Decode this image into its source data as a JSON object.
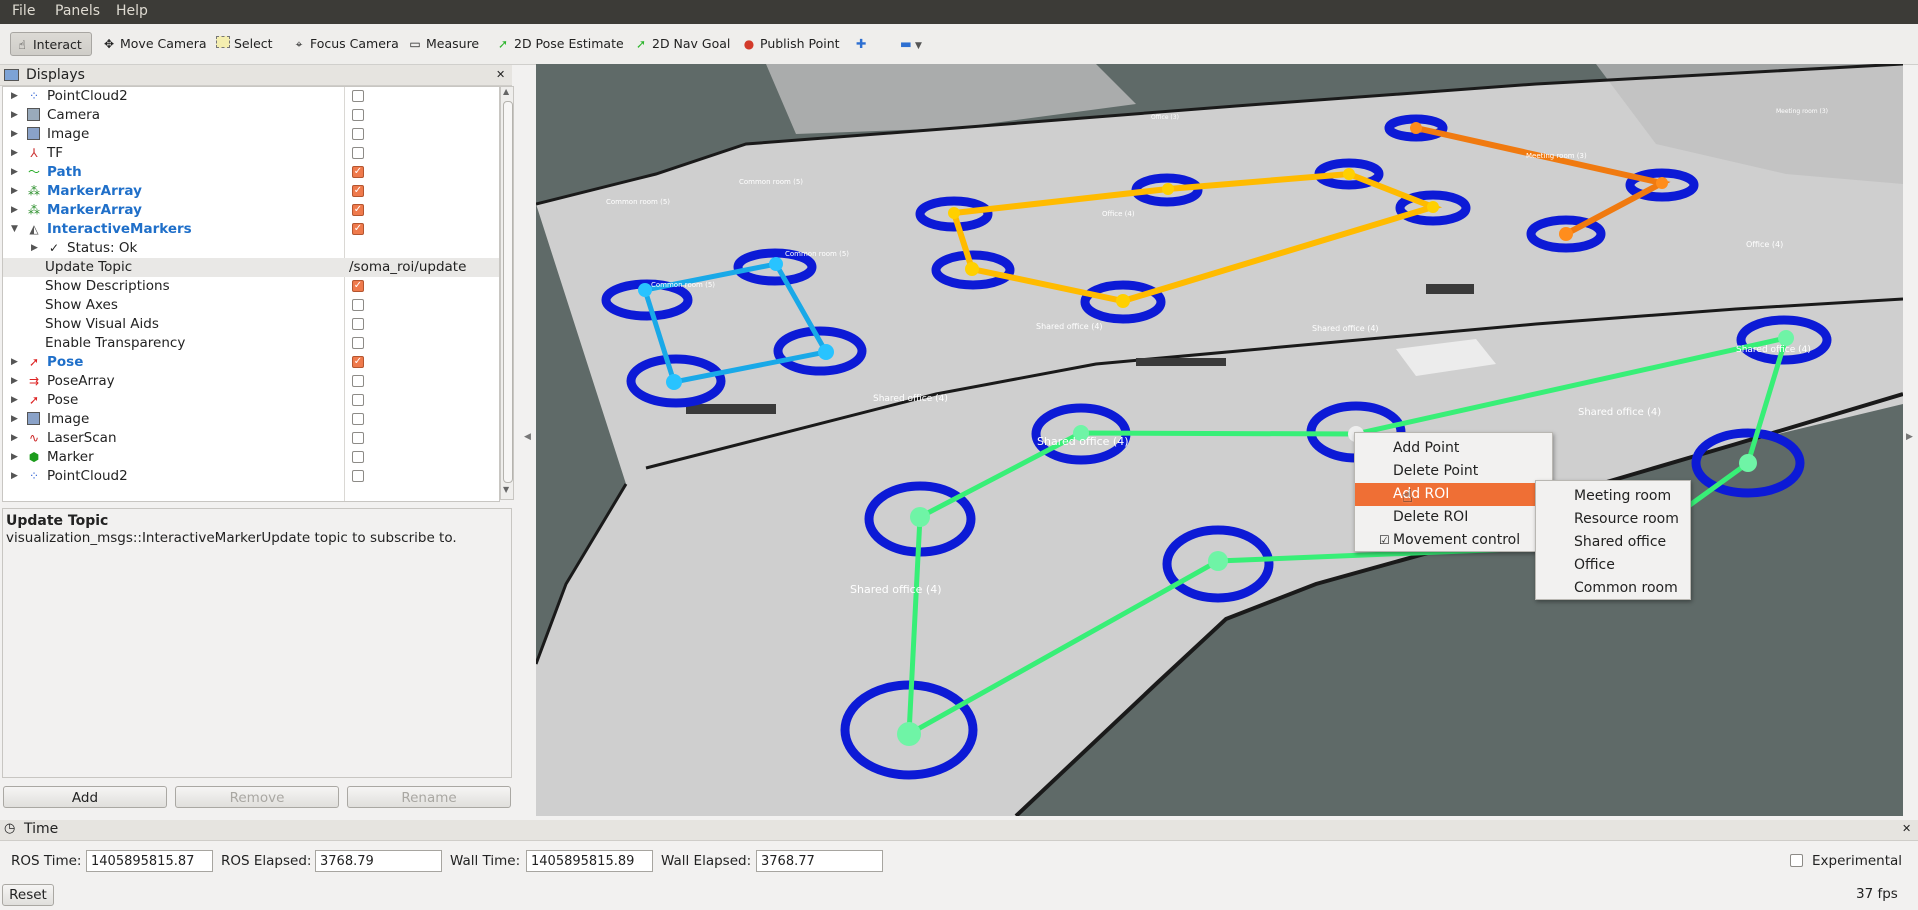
{
  "menu": [
    "File",
    "Panels",
    "Help"
  ],
  "toolbar": {
    "interact": "Interact",
    "move_camera": "Move Camera",
    "select": "Select",
    "focus_camera": "Focus Camera",
    "measure": "Measure",
    "pose_estimate": "2D Pose Estimate",
    "nav_goal": "2D Nav Goal",
    "publish_point": "Publish Point"
  },
  "displays": {
    "title": "Displays",
    "rows": [
      {
        "label": "PointCloud2"
      },
      {
        "label": "Camera"
      },
      {
        "label": "Image"
      },
      {
        "label": "TF"
      },
      {
        "label": "Path"
      },
      {
        "label": "MarkerArray"
      },
      {
        "label": "MarkerArray"
      },
      {
        "label": "InteractiveMarkers"
      },
      {
        "label": "Status: Ok"
      },
      {
        "label": "Update Topic",
        "value": "/soma_roi/update"
      },
      {
        "label": "Show Descriptions"
      },
      {
        "label": "Show Axes"
      },
      {
        "label": "Show Visual Aids"
      },
      {
        "label": "Enable Transparency"
      },
      {
        "label": "Pose"
      },
      {
        "label": "PoseArray"
      },
      {
        "label": "Pose"
      },
      {
        "label": "Image"
      },
      {
        "label": "LaserScan"
      },
      {
        "label": "Marker"
      },
      {
        "label": "PointCloud2"
      }
    ]
  },
  "description": {
    "title": "Update Topic",
    "text": "visualization_msgs::InteractiveMarkerUpdate topic to subscribe to."
  },
  "buttons": {
    "add": "Add",
    "remove": "Remove",
    "rename": "Rename"
  },
  "map_labels": [
    "Shared office (4)",
    "Shared office (4)",
    "Shared office (4)",
    "Shared office (4)",
    "Shared office (4)",
    "Shared office (4)",
    "Shared office (4)",
    "Office (4)",
    "Office (4)",
    "Office (3)",
    "Common room (5)",
    "Common room (5)",
    "Common room (5)",
    "Meeting room (3)",
    "Common room (5)",
    "Meeting room (3)"
  ],
  "context_menu": {
    "items": [
      "Add Point",
      "Delete Point",
      "Add ROI",
      "Delete ROI",
      "Movement control"
    ],
    "submenu": [
      "Meeting room",
      "Resource room",
      "Shared office",
      "Office",
      "Common room"
    ]
  },
  "time": {
    "title": "Time",
    "ros_time_label": "ROS Time:",
    "ros_time": "1405895815.87",
    "ros_elapsed_label": "ROS Elapsed:",
    "ros_elapsed": "3768.79",
    "wall_time_label": "Wall Time:",
    "wall_time": "1405895815.89",
    "wall_elapsed_label": "Wall Elapsed:",
    "wall_elapsed": "3768.77",
    "experimental": "Experimental",
    "reset": "Reset",
    "fps": "37 fps"
  }
}
